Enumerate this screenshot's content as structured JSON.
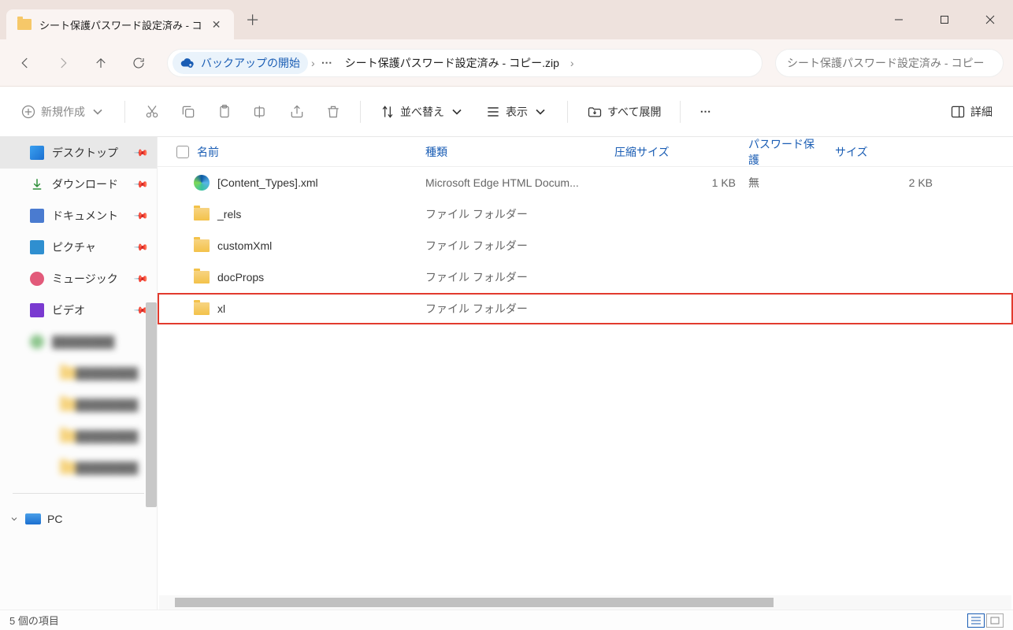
{
  "tab": {
    "title": "シート保護パスワード設定済み - コ"
  },
  "breadcrumb": {
    "backup_label": "バックアップの開始",
    "zip_label": "シート保護パスワード設定済み - コピー.zip"
  },
  "search": {
    "placeholder": "シート保護パスワード設定済み - コピー"
  },
  "toolbar": {
    "new_label": "新規作成",
    "sort_label": "並べ替え",
    "view_label": "表示",
    "extract_label": "すべて展開",
    "details_label": "詳細"
  },
  "sidebar": {
    "items": [
      {
        "label": "デスクトップ"
      },
      {
        "label": "ダウンロード"
      },
      {
        "label": "ドキュメント"
      },
      {
        "label": "ピクチャ"
      },
      {
        "label": "ミュージック"
      },
      {
        "label": "ビデオ"
      }
    ],
    "pc_label": "PC"
  },
  "columns": {
    "name": "名前",
    "type": "種類",
    "csize": "圧縮サイズ",
    "pwd": "パスワード保護",
    "size": "サイズ"
  },
  "files": [
    {
      "name": "[Content_Types].xml",
      "type": "Microsoft Edge HTML Docum...",
      "csize": "1 KB",
      "pwd": "無",
      "size": "2 KB",
      "icon": "edge"
    },
    {
      "name": "_rels",
      "type": "ファイル フォルダー",
      "csize": "",
      "pwd": "",
      "size": "",
      "icon": "folder"
    },
    {
      "name": "customXml",
      "type": "ファイル フォルダー",
      "csize": "",
      "pwd": "",
      "size": "",
      "icon": "folder"
    },
    {
      "name": "docProps",
      "type": "ファイル フォルダー",
      "csize": "",
      "pwd": "",
      "size": "",
      "icon": "folder"
    },
    {
      "name": "xl",
      "type": "ファイル フォルダー",
      "csize": "",
      "pwd": "",
      "size": "",
      "icon": "folder",
      "highlight": true
    }
  ],
  "status": {
    "count_label": "5 個の項目"
  }
}
